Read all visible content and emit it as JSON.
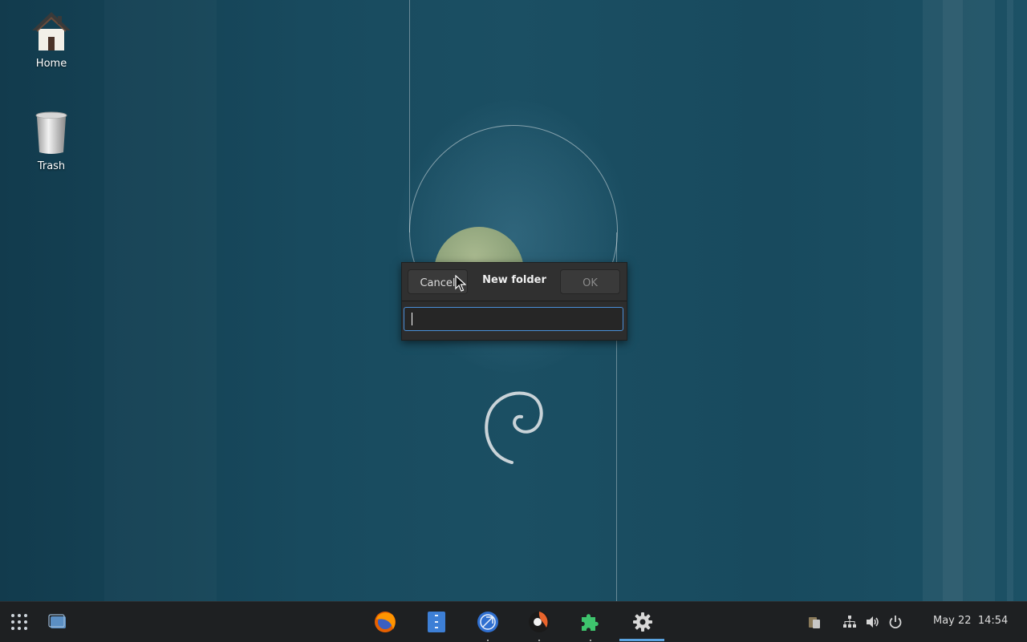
{
  "desktop": {
    "icons": [
      {
        "label": "Home",
        "icon": "home-folder-icon"
      },
      {
        "label": "Trash",
        "icon": "trash-icon"
      }
    ]
  },
  "dialog": {
    "title": "New folder",
    "cancel_label": "Cancel",
    "ok_label": "OK",
    "input_value": ""
  },
  "panel": {
    "app_grid_icon": "app-grid-icon",
    "show_windows_icon": "windows-icon",
    "taskbar": [
      {
        "name": "firefox-icon"
      },
      {
        "name": "text-editor-icon"
      },
      {
        "name": "browser-icon"
      },
      {
        "name": "system-monitor-icon"
      },
      {
        "name": "extensions-puzzle-icon"
      },
      {
        "name": "settings-gear-icon"
      }
    ],
    "tray": [
      "clipboard-icon",
      "network-icon",
      "volume-icon",
      "power-icon"
    ],
    "date": "May 22",
    "time": "14:54"
  },
  "colors": {
    "accent": "#5aa3e0",
    "desktop_bg": "#184a5e",
    "panel_bg": "#1e2022",
    "dialog_bg": "#2d2d2d"
  }
}
